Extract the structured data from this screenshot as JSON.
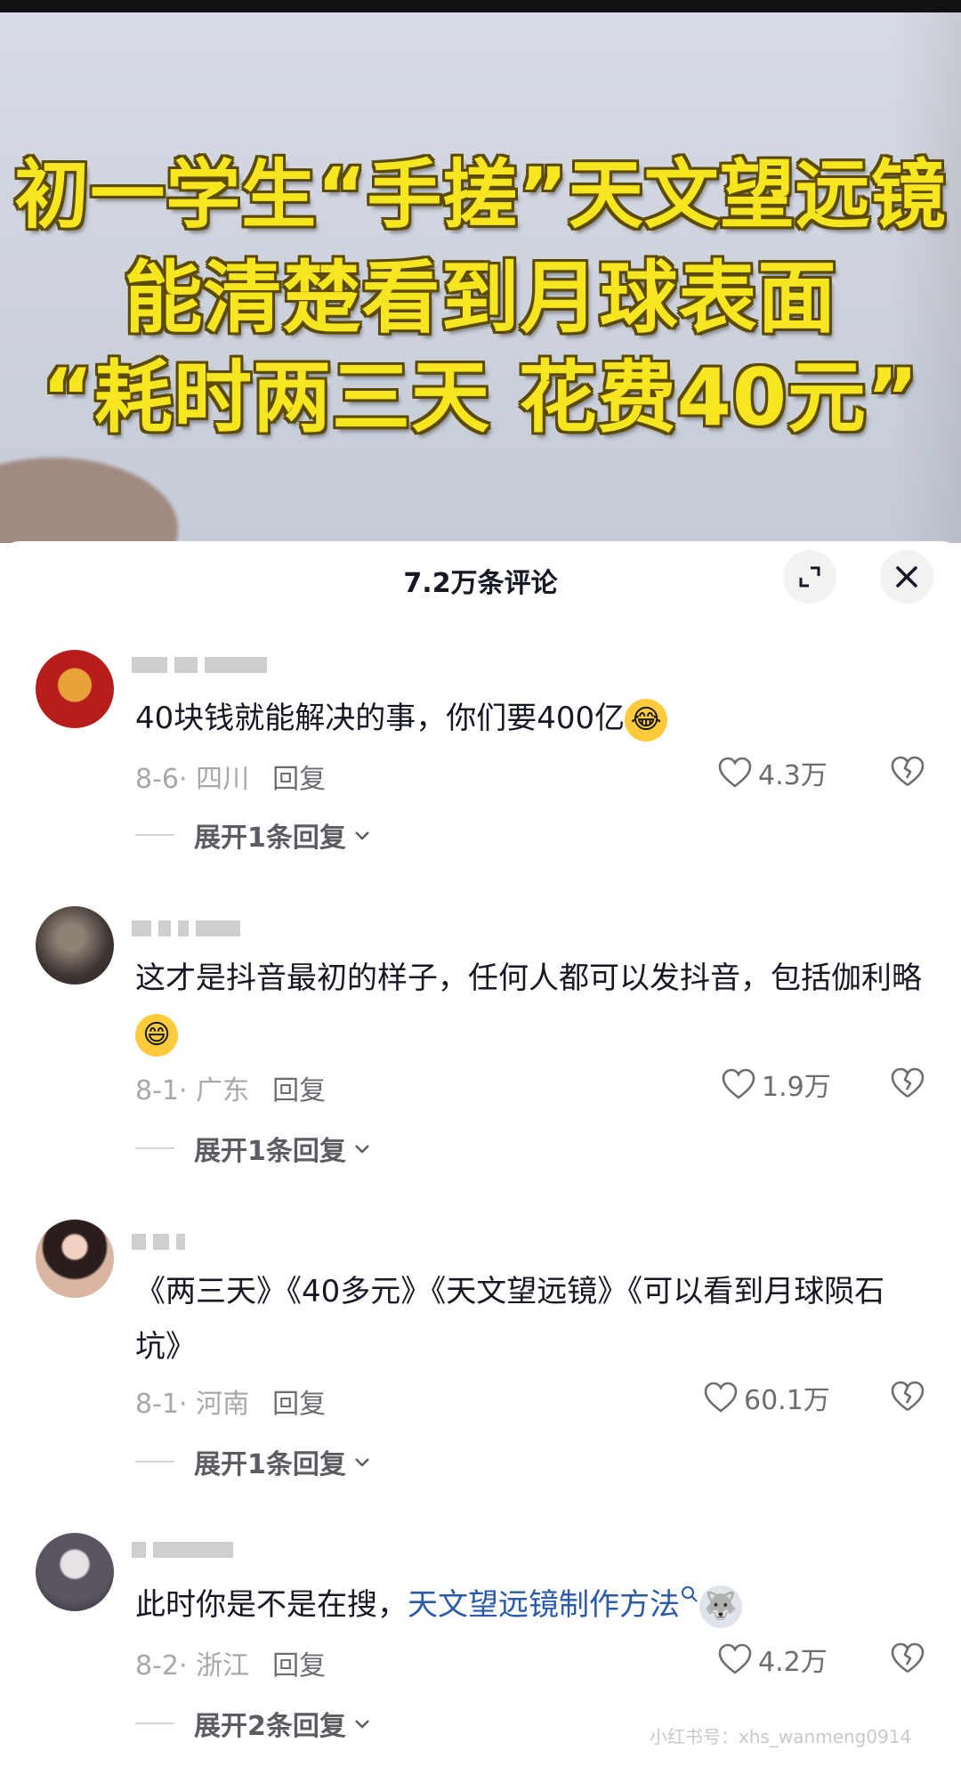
{
  "video": {
    "headline_line1": "初一学生“手搓”天文望远镜",
    "headline_line2": "能清楚看到月球表面",
    "headline_line3": "“耗时两三天 花费40元”"
  },
  "comments_panel": {
    "title": "7.2万条评论",
    "expand_icon": "expand-icon",
    "close_icon": "close-icon"
  },
  "comments": [
    {
      "text": "40块钱就能解决的事，你们要400亿",
      "emoji": "laughing-tears-emoji",
      "date_location": "8-6· 四川",
      "reply_label": "回复",
      "likes": "4.3万",
      "expand_label": "展开1条回复"
    },
    {
      "text": "这才是抖音最初的样子，任何人都可以发抖音，包括伽利略",
      "emoji": "grin-emoji",
      "date_location": "8-1· 广东",
      "reply_label": "回复",
      "likes": "1.9万",
      "expand_label": "展开1条回复"
    },
    {
      "text": "《两三天》《40多元》《天文望远镜》《可以看到月球陨石坑》",
      "date_location": "8-1· 河南",
      "reply_label": "回复",
      "likes": "60.1万",
      "expand_label": "展开1条回复"
    },
    {
      "text_prefix": "此时你是不是在搜，",
      "search_link": "天文望远镜制作方法",
      "emoji": "husky-emoji",
      "date_location": "8-2· 浙江",
      "reply_label": "回复",
      "likes": "4.2万",
      "expand_label": "展开2条回复"
    }
  ],
  "watermark": "小红书号：xhs_wanmeng0914",
  "colors": {
    "headline_yellow": "#f6e61f",
    "link_blue": "#2b5ba8",
    "text_dark": "#161823",
    "meta_gray": "#a7a8ac"
  }
}
